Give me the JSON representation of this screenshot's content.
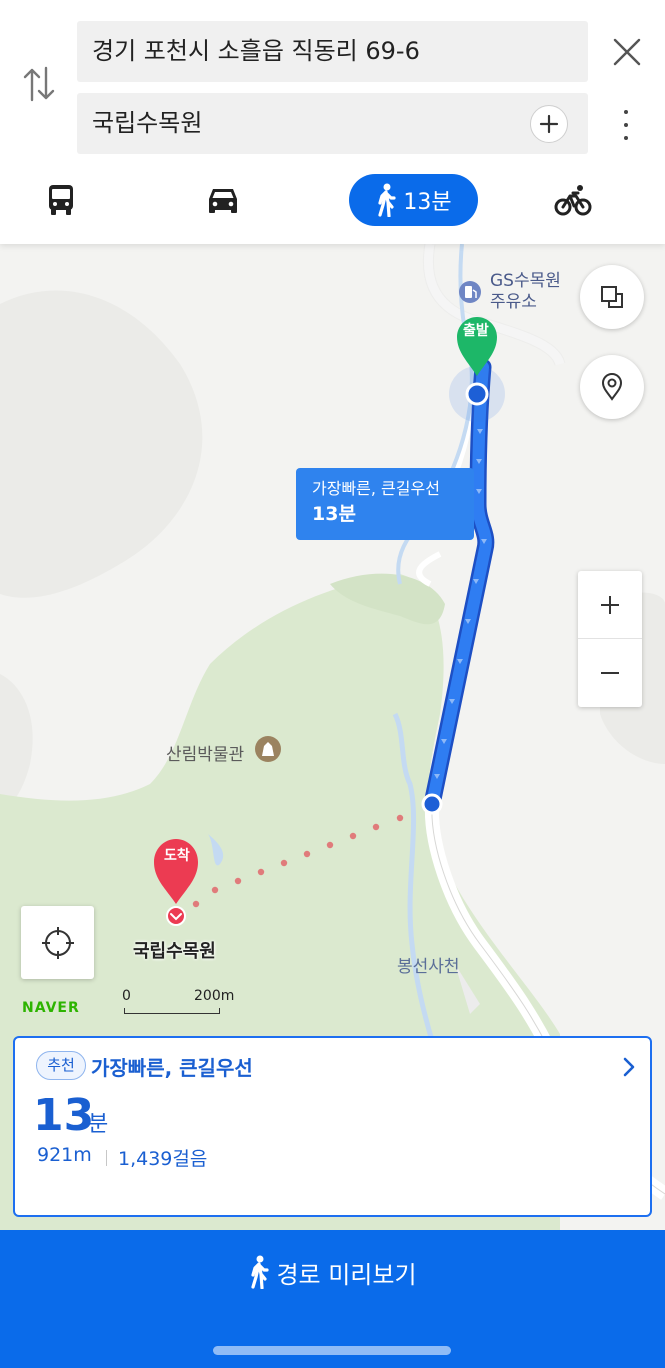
{
  "search": {
    "origin": "경기 포천시 소흘읍 직동리 69-6",
    "destination": "국립수목원"
  },
  "modes": {
    "walk_time": "13분",
    "selected": "walk"
  },
  "map": {
    "route_bubble_title": "가장빠른, 큰길우선",
    "route_bubble_time": "13분",
    "gs_station_line1": "GS수목원",
    "gs_station_line2": "주유소",
    "start_marker": "출발",
    "end_marker": "도착",
    "museum_label": "산림박물관",
    "destination_label": "국립수목원",
    "temple_label": "봉선사천",
    "brand": "NAVER",
    "scale_start": "0",
    "scale_end": "200m"
  },
  "route_card": {
    "badge": "추천",
    "title": "가장빠른, 큰길우선",
    "time_number": "13",
    "time_unit": "분",
    "distance": "921m",
    "steps": "1,439걸음"
  },
  "bottom": {
    "preview_label": "경로 미리보기"
  },
  "colors": {
    "accent": "#0a6bea",
    "route": "#1d6ff0",
    "start": "#1db768",
    "end": "#ec3b52",
    "park": "#dcead0"
  }
}
